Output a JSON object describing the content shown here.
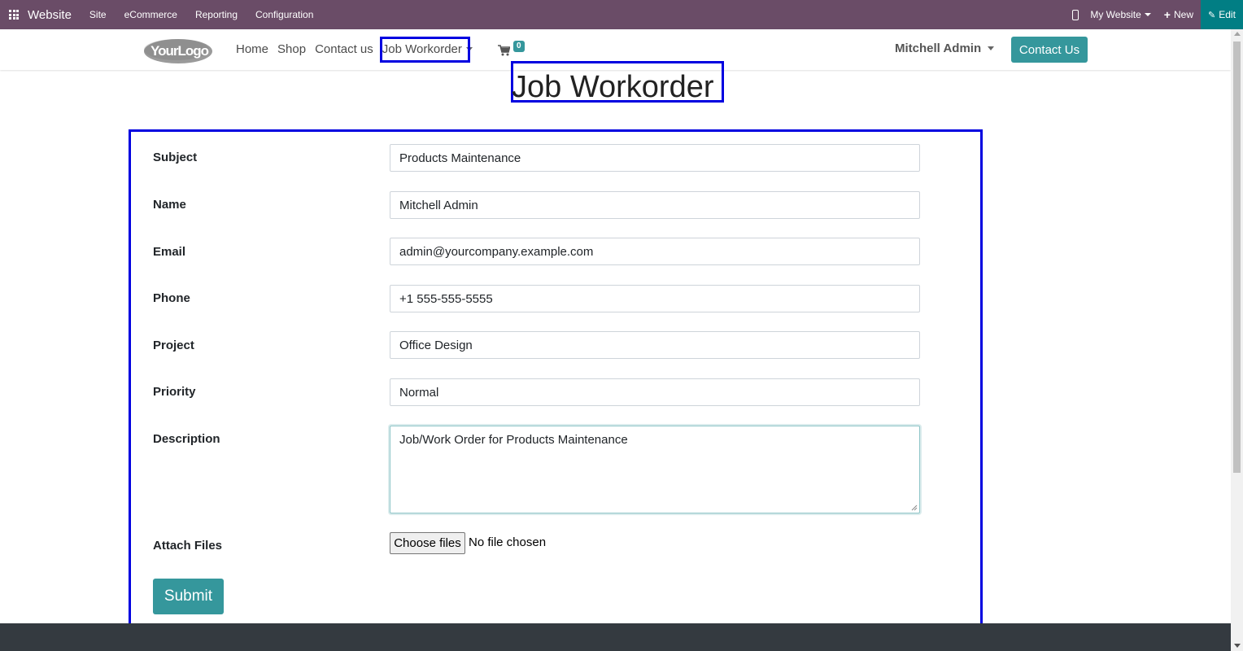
{
  "adminbar": {
    "app_name": "Website",
    "menu": [
      "Site",
      "eCommerce",
      "Reporting",
      "Configuration"
    ],
    "website_selector": "My Website",
    "new_label": "New",
    "edit_label": "Edit",
    "icons": [
      "apps-grid-icon",
      "mobile-icon",
      "plus-icon",
      "pencil-icon"
    ]
  },
  "navbar": {
    "logo_text": "YourLogo",
    "links": [
      "Home",
      "Shop",
      "Contact us"
    ],
    "dropdown_label": "Job Workorder",
    "cart_count": "0",
    "user_name": "Mitchell Admin",
    "contact_button": "Contact Us"
  },
  "page": {
    "title": "Job Workorder"
  },
  "form": {
    "fields": [
      {
        "label": "Subject",
        "value": "Products Maintenance"
      },
      {
        "label": "Name",
        "value": "Mitchell Admin"
      },
      {
        "label": "Email",
        "value": "admin@yourcompany.example.com"
      },
      {
        "label": "Phone",
        "value": "+1 555-555-5555"
      },
      {
        "label": "Project",
        "value": "Office Design"
      },
      {
        "label": "Priority",
        "value": "Normal"
      }
    ],
    "description": {
      "label": "Description",
      "value": "Job/Work Order for Products Maintenance"
    },
    "attach": {
      "label": "Attach Files",
      "button": "Choose files",
      "status": "No file chosen"
    },
    "submit_label": "Submit"
  },
  "colors": {
    "adminbar_bg": "#6a4c67",
    "edit_bg": "#017e84",
    "primary": "#35979c",
    "footer_bg": "#343a40",
    "highlight": "#0000e0"
  }
}
